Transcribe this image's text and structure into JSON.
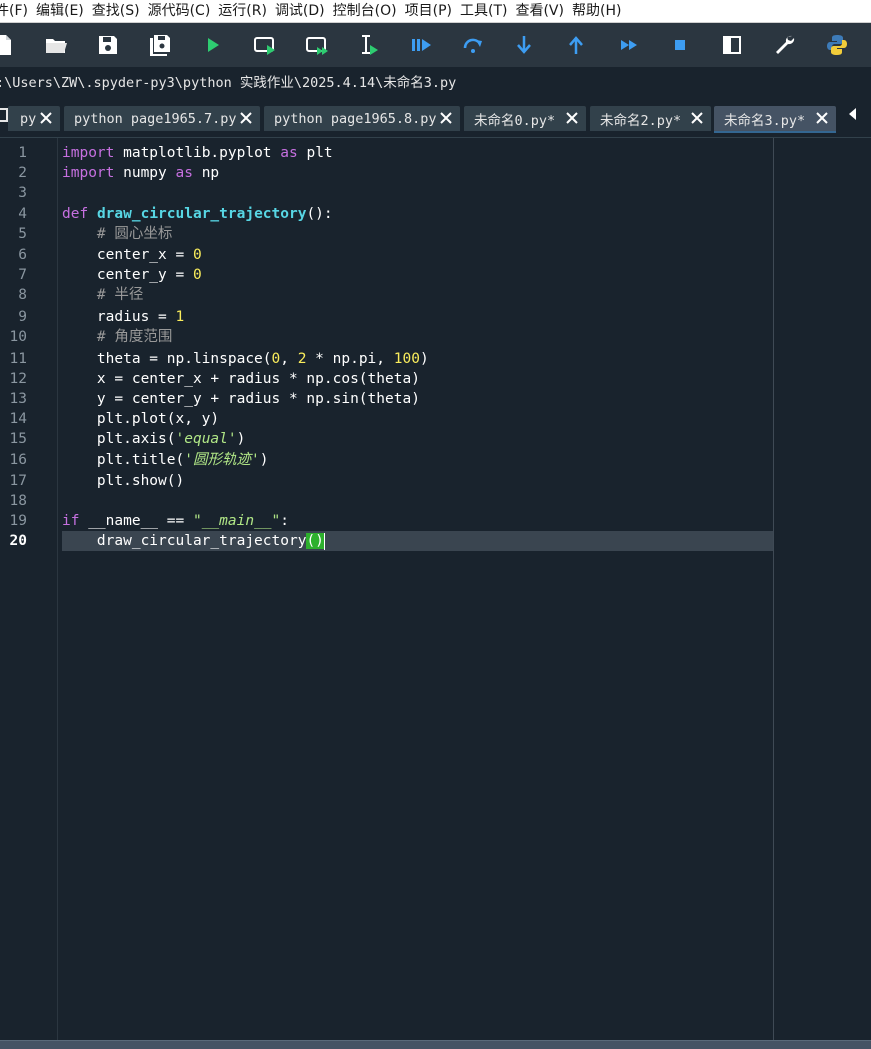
{
  "menu": {
    "items": [
      "件(F)",
      "编辑(E)",
      "查找(S)",
      "源代码(C)",
      "运行(R)",
      "调试(D)",
      "控制台(O)",
      "项目(P)",
      "工具(T)",
      "查看(V)",
      "帮助(H)"
    ]
  },
  "toolbar": {
    "buttons": [
      "new-file",
      "open-file",
      "save-file",
      "save-all",
      "run-file",
      "run-cell",
      "run-cell-advance",
      "run-selection",
      "debug-file",
      "debug-step",
      "debug-step-into",
      "debug-step-return",
      "debug-continue",
      "debug-stop",
      "maximize-pane",
      "preferences",
      "python-path-manager"
    ]
  },
  "path": {
    "text": ":\\Users\\ZW\\.spyder-py3\\python 实践作业\\2025.4.14\\未命名3.py"
  },
  "tabs": [
    {
      "label": "py"
    },
    {
      "label": "python page1965.7.py"
    },
    {
      "label": "python page1965.8.py"
    },
    {
      "label": "未命名0.py*"
    },
    {
      "label": "未命名2.py*"
    },
    {
      "label": "未命名3.py*",
      "active": true
    }
  ],
  "editor": {
    "line_numbers": [
      "1",
      "2",
      "3",
      "4",
      "5",
      "6",
      "7",
      "8",
      "9",
      "10",
      "11",
      "12",
      "13",
      "14",
      "15",
      "16",
      "17",
      "18",
      "19",
      "20"
    ],
    "current_line": "20",
    "code": {
      "l1a": "import",
      "l1b": " matplotlib.pyplot ",
      "l1c": "as",
      "l1d": " plt",
      "l2a": "import",
      "l2b": " numpy ",
      "l2c": "as",
      "l2d": " np",
      "l4a": "def",
      "l4b": " ",
      "l4c": "draw_circular_trajectory",
      "l4d": "():",
      "l5": "    # 圆心坐标",
      "l6a": "    center_x = ",
      "l6b": "0",
      "l7a": "    center_y = ",
      "l7b": "0",
      "l8": "    # 半径",
      "l9a": "    radius = ",
      "l9b": "1",
      "l10": "    # 角度范围",
      "l11a": "    theta = np.linspace(",
      "l11b": "0",
      "l11c": ", ",
      "l11d": "2",
      "l11e": " * np.pi, ",
      "l11f": "100",
      "l11g": ")",
      "l12": "    x = center_x + radius * np.cos(theta)",
      "l13": "    y = center_y + radius * np.sin(theta)",
      "l14": "    plt.plot(x, y)",
      "l15a": "    plt.axis(",
      "l15b": "'equal'",
      "l15c": ")",
      "l16a": "    plt.title(",
      "l16b": "'圆形轨迹'",
      "l16c": ")",
      "l17": "    plt.show()",
      "l19a": "if",
      "l19b": " __name__ == ",
      "l19c": "\"__main__\"",
      "l19d": ":",
      "l20a": "    draw_circular_trajectory",
      "l20b": "()"
    }
  },
  "colors": {
    "background": "#19232d",
    "keyword": "#c670e0",
    "function_def": "#57d6e4",
    "number": "#faed5c",
    "string": "#b0e686",
    "comment": "#999999",
    "brace_match": "#2db02d"
  }
}
